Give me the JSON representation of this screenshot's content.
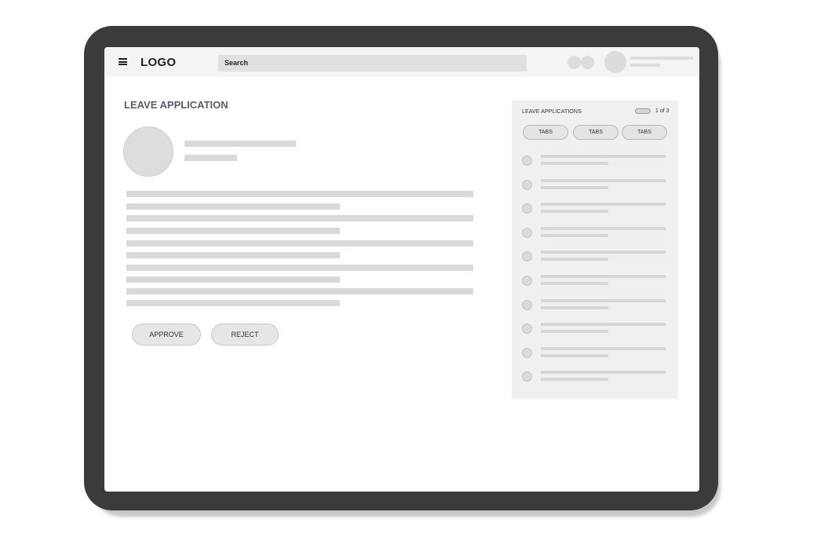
{
  "header": {
    "logo": "LOGO",
    "search_placeholder": "Search",
    "menu_icon": "hamburger-icon"
  },
  "main": {
    "title": "LEAVE APPLICATION",
    "approve_label": "APPROVE",
    "reject_label": "REJECT"
  },
  "sidebar": {
    "title": "LEAVE APPLICATIONS",
    "pager": "1 of 3",
    "tabs": [
      {
        "label": "TABS"
      },
      {
        "label": "TABS"
      },
      {
        "label": "TABS"
      }
    ]
  },
  "colors": {
    "device_frame": "#3b3b3b",
    "placeholder_gray": "#d9d9d9",
    "title_text": "#5a5a6a"
  }
}
